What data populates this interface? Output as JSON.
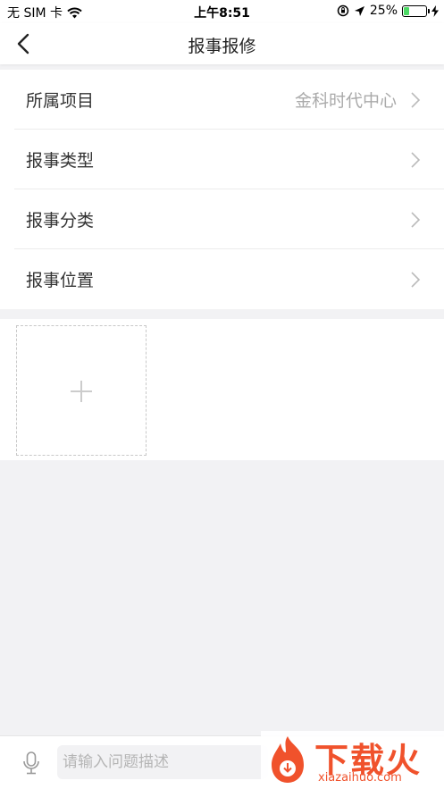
{
  "status_bar": {
    "carrier": "无 SIM 卡",
    "time": "上午8:51",
    "battery_percent": "25%",
    "battery_level": 0.25
  },
  "nav": {
    "title": "报事报修"
  },
  "form": {
    "rows": [
      {
        "label": "所属项目",
        "value": "金科时代中心"
      },
      {
        "label": "报事类型",
        "value": ""
      },
      {
        "label": "报事分类",
        "value": ""
      },
      {
        "label": "报事位置",
        "value": ""
      }
    ]
  },
  "input_bar": {
    "placeholder": "请输入问题描述"
  },
  "watermark": {
    "text": "下载火",
    "url": "xiazaihuo.com"
  },
  "colors": {
    "accent": "#f0522c",
    "battery": "#4cd964",
    "background": "#f2f2f4"
  }
}
